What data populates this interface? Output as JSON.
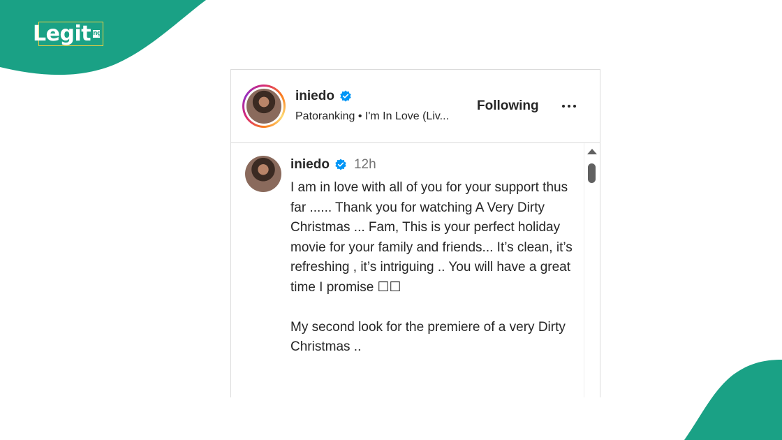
{
  "brand": {
    "logo_text": "Legit",
    "logo_suffix": "ng",
    "accent_color": "#1aa185",
    "frame_color": "#f4d03f"
  },
  "post_header": {
    "username": "iniedo",
    "verified": true,
    "audio_label": "Patoranking • I'm In Love (Liv...",
    "follow_label": "Following",
    "more_icon": "more-horizontal-icon"
  },
  "comment": {
    "username": "iniedo",
    "verified": true,
    "time": "12h",
    "text": "I am in love with all of you for your support thus far ...... Thank you for watching A Very Dirty Christmas ... Fam, This is your perfect holiday movie for your family and friends... It’s clean, it’s refreshing , it’s intriguing .. You will have a great time I promise ☐☐\n\nMy second look for the premiere of a very Dirty Christmas .."
  }
}
